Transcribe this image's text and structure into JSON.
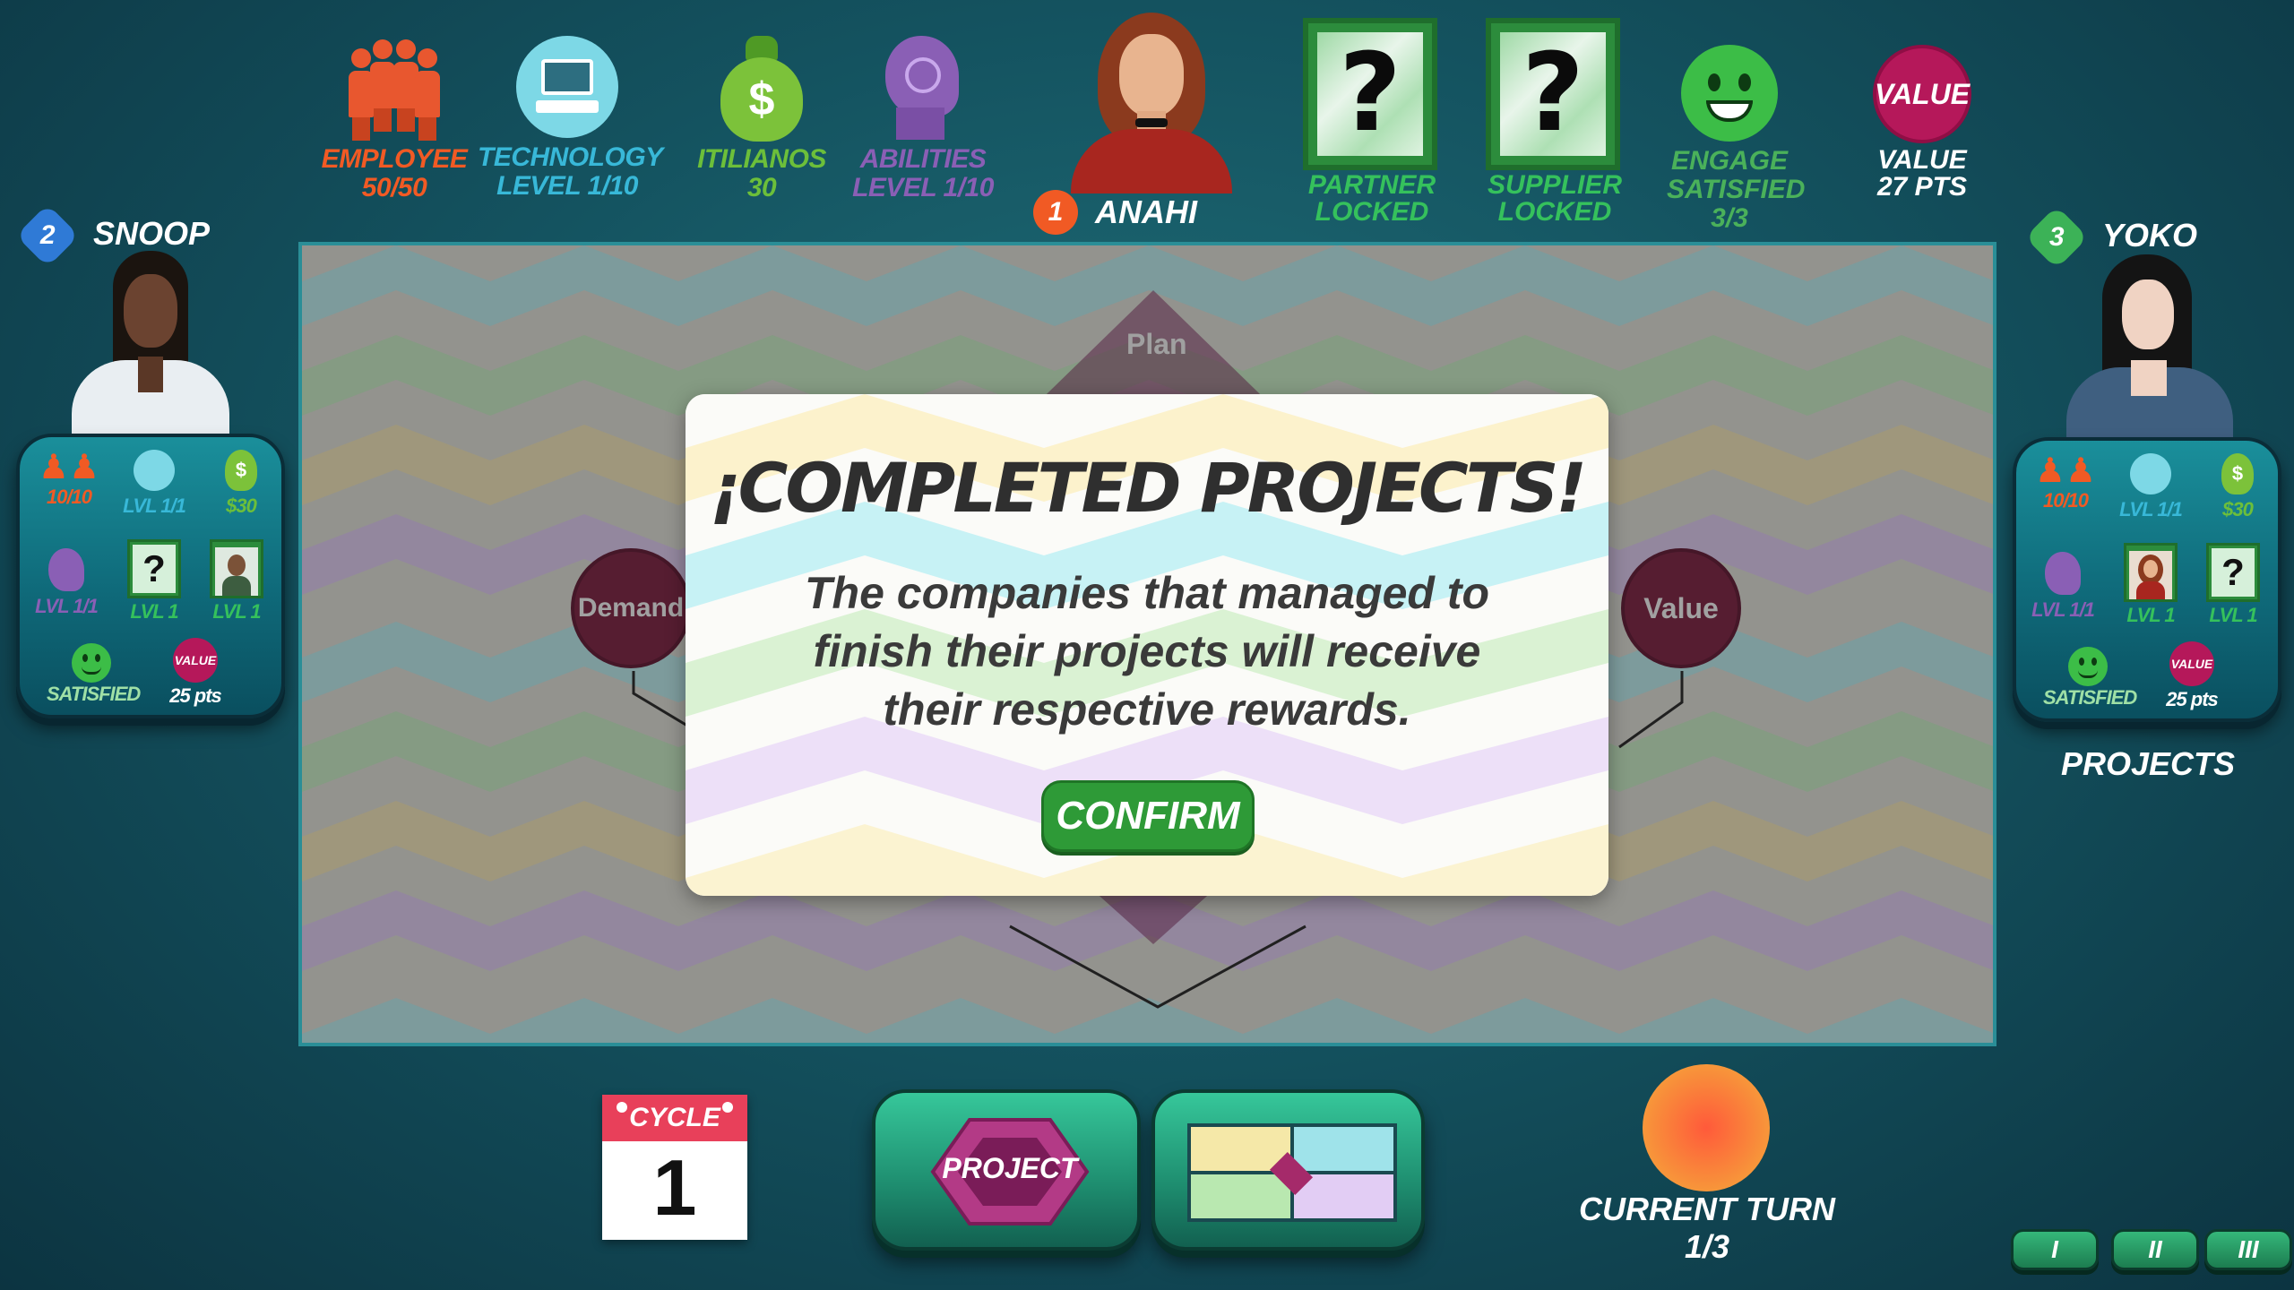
{
  "top_stats": {
    "employee": {
      "label": "EMPLOYEE",
      "value": "50/50",
      "color": "#f15a24"
    },
    "technology": {
      "label": "TECHNOLOGY",
      "value": "LEVEL  1/10",
      "color": "#38b8d8"
    },
    "itilianos": {
      "label": "ITILIANOS",
      "value": "30",
      "color": "#6cbf3a"
    },
    "abilities": {
      "label": "ABILITIES",
      "value": "LEVEL  1/10",
      "color": "#8a5fb5"
    },
    "current_player": {
      "number": "1",
      "name": "ANAHI"
    },
    "partner": {
      "label": "PARTNER",
      "value": "LOCKED",
      "icon": "question-card"
    },
    "supplier": {
      "label": "SUPPLIER",
      "value": "LOCKED",
      "icon": "question-card"
    },
    "engage": {
      "label": "ENGAGE",
      "value": "SATISFIED",
      "count": "3/3"
    },
    "value": {
      "badge": "VALUE",
      "label": "VALUE",
      "points": "27 PTS"
    }
  },
  "left_player": {
    "number": "2",
    "name": "SNOOP",
    "employee": "10/10",
    "technology": "LVL 1/1",
    "money": "$30",
    "abilities": "LVL 1/1",
    "partner": "LVL 1",
    "supplier": "LVL 1",
    "satisfied": "SATISFIED",
    "value_badge": "VALUE",
    "points": "25 pts"
  },
  "right_player": {
    "number": "3",
    "name": "YOKO",
    "employee": "10/10",
    "technology": "LVL 1/1",
    "money": "$30",
    "abilities": "LVL 1/1",
    "partner": "LVL 1",
    "supplier": "LVL 1",
    "satisfied": "SATISFIED",
    "value_badge": "VALUE",
    "points": "25 pts",
    "projects_label": "PROJECTS"
  },
  "board": {
    "plan_label": "Plan",
    "demand_label": "Demand",
    "value_label": "Value"
  },
  "modal": {
    "title": "¡COMPLETED PROJECTS!",
    "body_line1": "The companies that managed to",
    "body_line2": "finish their projects will receive",
    "body_line3": "their respective rewards.",
    "confirm": "CONFIRM"
  },
  "bottom": {
    "cycle_label": "CYCLE",
    "cycle_number": "1",
    "project_button": "PROJECT",
    "current_turn_label": "CURRENT TURN",
    "current_turn_value": "1/3",
    "roman_buttons": [
      "I",
      "II",
      "III"
    ]
  },
  "colors": {
    "employee": "#f15a24",
    "technology": "#38b8d8",
    "money": "#6cbf3a",
    "abilities": "#8a5fb5",
    "value_badge": "#b5185a",
    "confirm": "#2e9a37"
  }
}
